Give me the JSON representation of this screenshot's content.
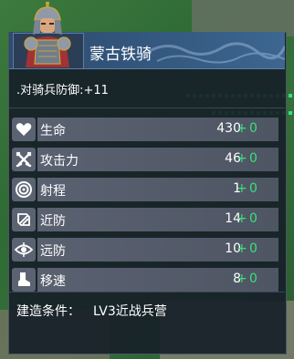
{
  "unit": {
    "name": "蒙古铁骑",
    "bonus": ".对骑兵防御:+11"
  },
  "stats": [
    {
      "label": "生命",
      "icon": "heart-icon",
      "value": "430",
      "plus": "+",
      "increment": "0"
    },
    {
      "label": "攻击力",
      "icon": "crossed-swords-icon",
      "value": "46",
      "plus": "+",
      "increment": "0"
    },
    {
      "label": "射程",
      "icon": "target-icon",
      "value": "1",
      "plus": "+",
      "increment": "0"
    },
    {
      "label": "近防",
      "icon": "slash-shield-icon",
      "value": "14",
      "plus": "+",
      "increment": "0"
    },
    {
      "label": "远防",
      "icon": "eye-shield-icon",
      "value": "10",
      "plus": "+",
      "increment": "0"
    },
    {
      "label": "移速",
      "icon": "boot-icon",
      "value": "8",
      "plus": "+",
      "increment": "0"
    }
  ],
  "requirement": {
    "label": "建造条件：",
    "value": "LV3近战兵营"
  },
  "colors": {
    "increment_green": "#39e079",
    "title_bar": "#355a82",
    "panel": "#161e28"
  }
}
